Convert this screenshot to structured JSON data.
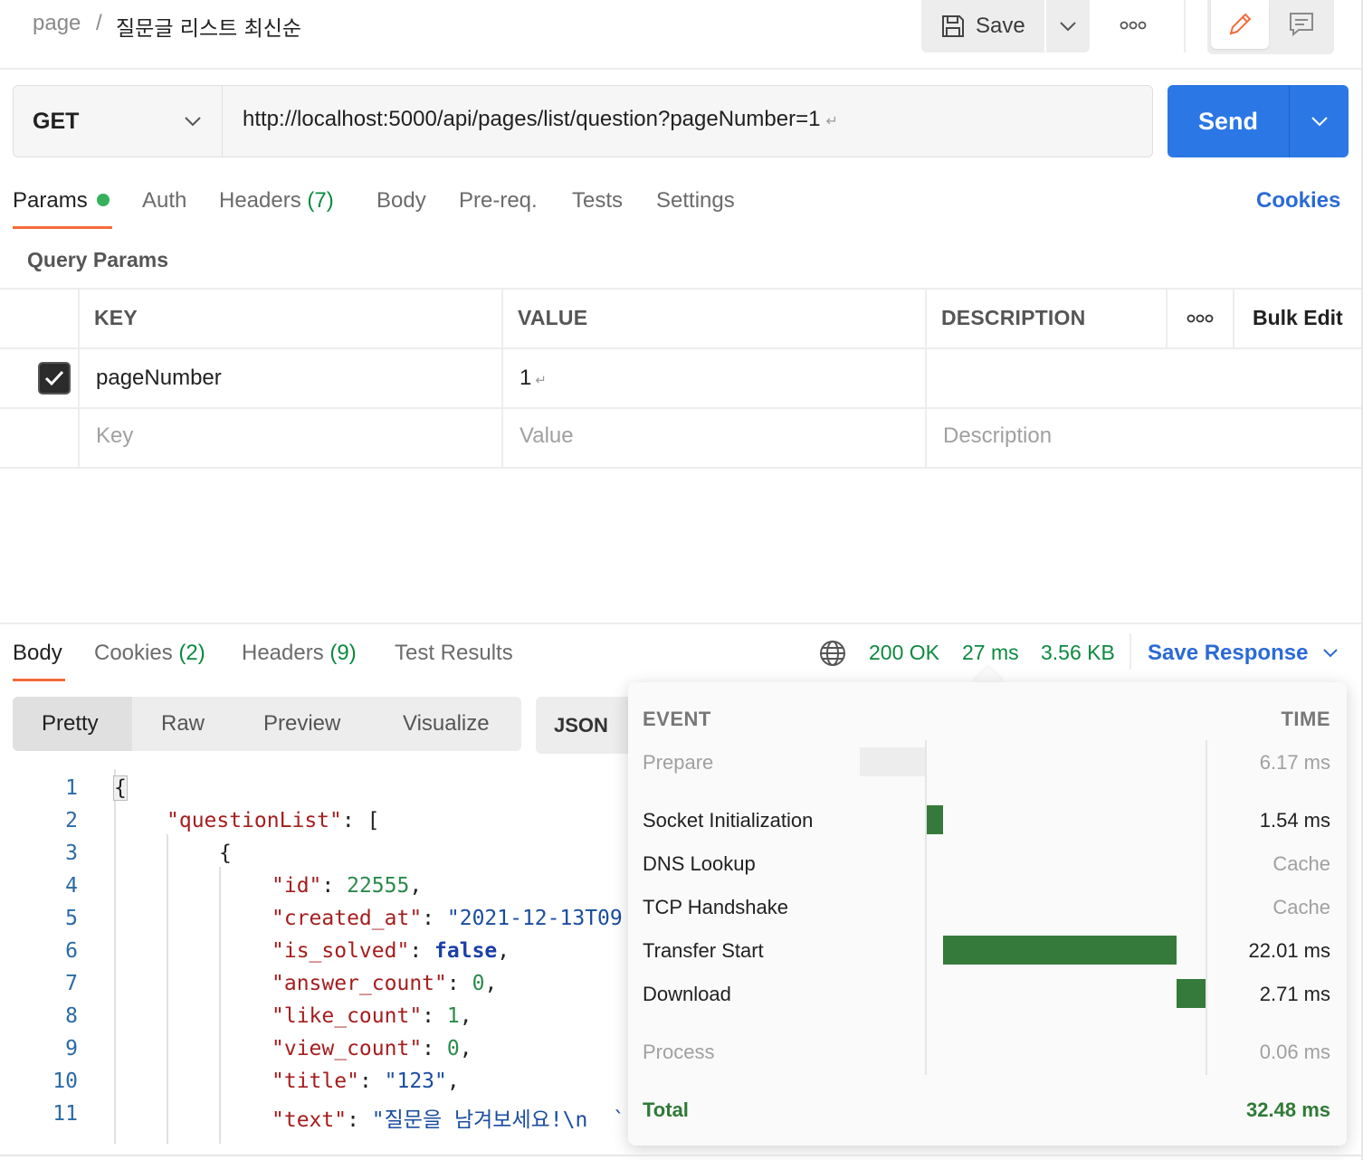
{
  "breadcrumb": {
    "parent": "page",
    "separator": "/",
    "title": "질문글 리스트 최신순"
  },
  "toolbar": {
    "save_label": "Save",
    "edit_icon": "pencil-icon",
    "comment_icon": "comment-icon"
  },
  "request": {
    "method": "GET",
    "url": "http://localhost:5000/api/pages/list/question?pageNumber=1",
    "send_label": "Send"
  },
  "request_tabs": {
    "params": "Params",
    "auth": "Auth",
    "headers": "Headers",
    "headers_count": "(7)",
    "body": "Body",
    "prereq": "Pre-req.",
    "tests": "Tests",
    "settings": "Settings",
    "cookies": "Cookies"
  },
  "query_params": {
    "title": "Query Params",
    "columns": {
      "key": "KEY",
      "value": "VALUE",
      "description": "DESCRIPTION",
      "bulk_edit": "Bulk Edit"
    },
    "rows": [
      {
        "checked": true,
        "key": "pageNumber",
        "value": "1",
        "description": ""
      }
    ],
    "placeholders": {
      "key": "Key",
      "value": "Value",
      "description": "Description"
    }
  },
  "response_tabs": {
    "body": "Body",
    "cookies": "Cookies",
    "cookies_count": "(2)",
    "headers": "Headers",
    "headers_count": "(9)",
    "test_results": "Test Results"
  },
  "response_status": {
    "status": "200 OK",
    "time": "27 ms",
    "size": "3.56 KB",
    "save_response": "Save Response"
  },
  "view_modes": {
    "pretty": "Pretty",
    "raw": "Raw",
    "preview": "Preview",
    "visualize": "Visualize",
    "format": "JSON"
  },
  "code_lines": {
    "l1": "{",
    "l2_key": "\"questionList\"",
    "l2_rest": ": [",
    "l3": "{",
    "l4_key": "\"id\"",
    "l4_val": "22555",
    "l5_key": "\"created_at\"",
    "l5_val": "\"2021-12-13T09",
    "l6_key": "\"is_solved\"",
    "l6_val": "false",
    "l7_key": "\"answer_count\"",
    "l7_val": "0",
    "l8_key": "\"like_count\"",
    "l8_val": "1",
    "l9_key": "\"view_count\"",
    "l9_val": "0",
    "l10_key": "\"title\"",
    "l10_val": "\"123\"",
    "l11_key": "\"text\"",
    "l11_val": "\"질문을 남겨보세요!\\n  `"
  },
  "line_numbers": [
    "1",
    "2",
    "3",
    "4",
    "5",
    "6",
    "7",
    "8",
    "9",
    "10",
    "11"
  ],
  "timing": {
    "header_event": "EVENT",
    "header_time": "TIME",
    "events": [
      {
        "name": "Prepare",
        "time": "6.17 ms"
      },
      {
        "name": "Socket Initialization",
        "time": "1.54 ms"
      },
      {
        "name": "DNS Lookup",
        "time": "Cache"
      },
      {
        "name": "TCP Handshake",
        "time": "Cache"
      },
      {
        "name": "Transfer Start",
        "time": "22.01 ms"
      },
      {
        "name": "Download",
        "time": "2.71 ms"
      },
      {
        "name": "Process",
        "time": "0.06 ms"
      }
    ],
    "total_label": "Total",
    "total_time": "32.48 ms"
  },
  "colors": {
    "accent": "#f26b3a",
    "send": "#2b77e5",
    "success": "#0b8a3e",
    "bar": "#357a3b",
    "link": "#2b6ad6"
  }
}
